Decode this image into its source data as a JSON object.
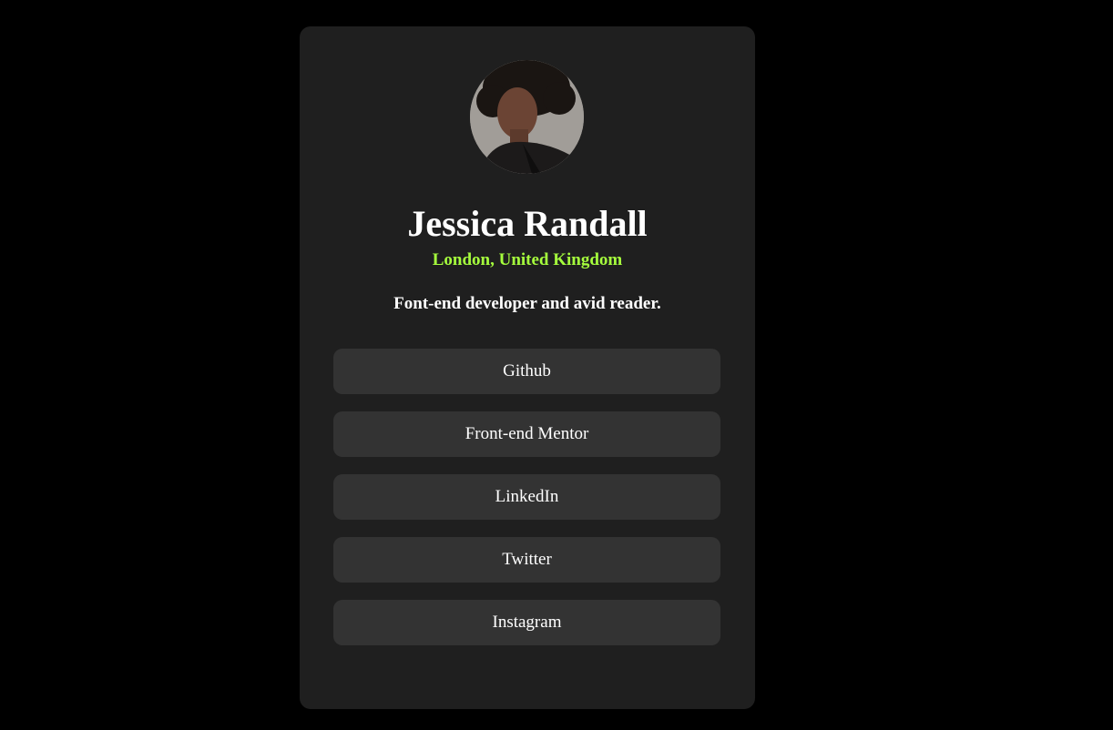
{
  "profile": {
    "name": "Jessica Randall",
    "location": "London, United Kingdom",
    "bio": "Font-end developer and avid reader.",
    "avatar_icon": "profile-photo"
  },
  "links": [
    {
      "label": "Github"
    },
    {
      "label": "Front-end Mentor"
    },
    {
      "label": "LinkedIn"
    },
    {
      "label": "Twitter"
    },
    {
      "label": "Instagram"
    }
  ],
  "colors": {
    "page_background": "#000000",
    "card_background": "#1f1f1f",
    "button_background": "#333333",
    "accent": "#a6ff3d",
    "text": "#ffffff"
  }
}
